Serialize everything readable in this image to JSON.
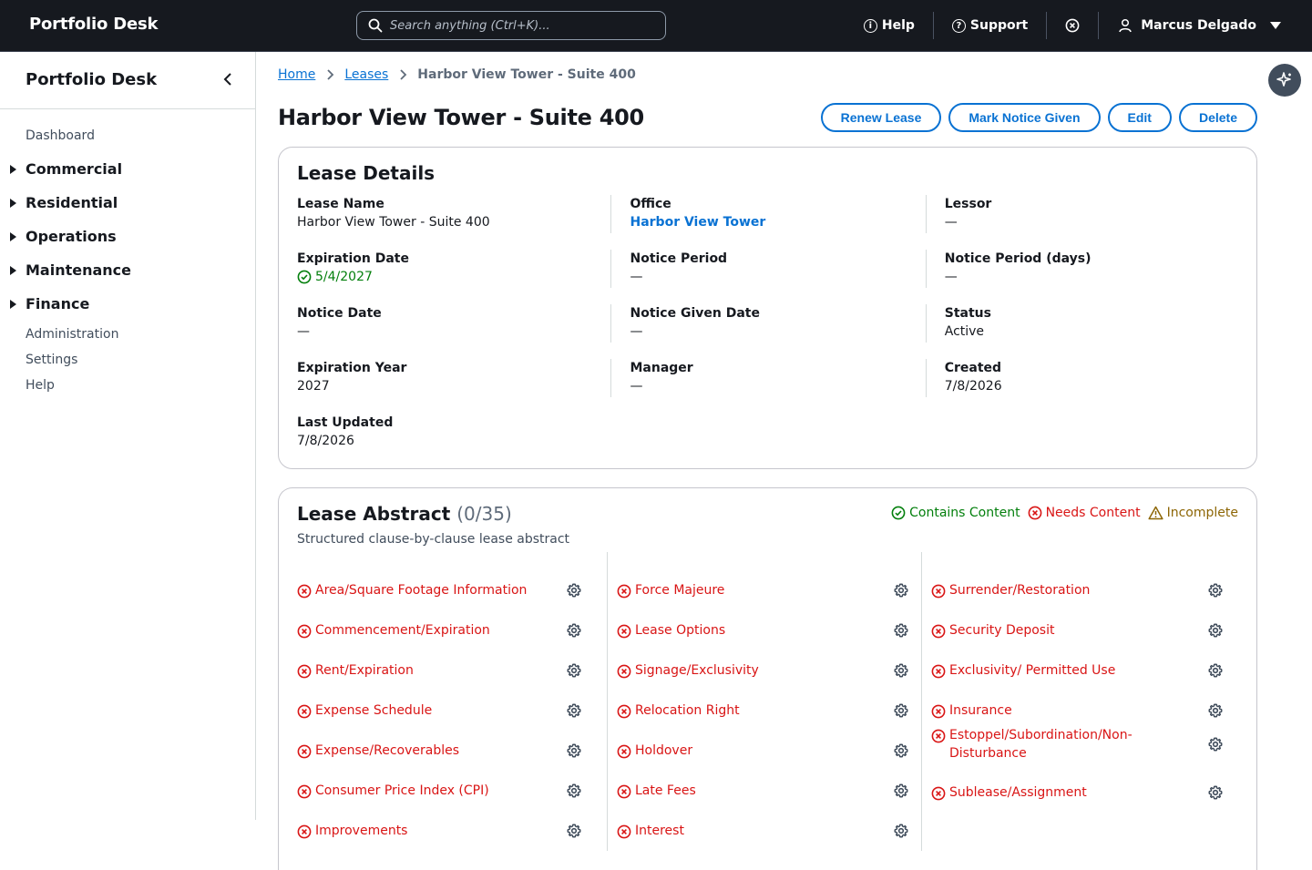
{
  "app": {
    "brand": "Portfolio Desk",
    "search_placeholder": "Search anything (Ctrl+K)...",
    "help_label": "Help",
    "support_label": "Support",
    "user_name": "Marcus Delgado"
  },
  "sidebar": {
    "title": "Portfolio Desk",
    "dashboard": "Dashboard",
    "groups": [
      "Commercial",
      "Residential",
      "Operations",
      "Maintenance",
      "Finance"
    ],
    "links": [
      "Administration",
      "Settings",
      "Help"
    ]
  },
  "breadcrumb": {
    "home": "Home",
    "leases": "Leases",
    "current": "Harbor View Tower - Suite 400"
  },
  "page": {
    "title": "Harbor View Tower - Suite 400",
    "actions": {
      "renew": "Renew Lease",
      "notice": "Mark Notice Given",
      "edit": "Edit",
      "delete": "Delete"
    }
  },
  "details": {
    "title": "Lease Details",
    "fields": {
      "lease_name": {
        "label": "Lease Name",
        "value": "Harbor View Tower - Suite 400"
      },
      "office": {
        "label": "Office",
        "value": "Harbor View Tower"
      },
      "lessor": {
        "label": "Lessor",
        "value": "—"
      },
      "expiration_date": {
        "label": "Expiration Date",
        "value": "5/4/2027"
      },
      "notice_period": {
        "label": "Notice Period",
        "value": "—"
      },
      "notice_period_days": {
        "label": "Notice Period (days)",
        "value": "—"
      },
      "notice_date": {
        "label": "Notice Date",
        "value": "—"
      },
      "notice_given_date": {
        "label": "Notice Given Date",
        "value": "—"
      },
      "status": {
        "label": "Status",
        "value": "Active"
      },
      "expiration_year": {
        "label": "Expiration Year",
        "value": "2027"
      },
      "manager": {
        "label": "Manager",
        "value": "—"
      },
      "created": {
        "label": "Created",
        "value": "7/8/2026"
      },
      "last_updated": {
        "label": "Last Updated",
        "value": "7/8/2026"
      }
    }
  },
  "abstract": {
    "title": "Lease Abstract",
    "count": "(0/35)",
    "subtitle": "Structured clause-by-clause lease abstract",
    "legend": {
      "contains": "Contains Content",
      "needs": "Needs Content",
      "incomplete": "Incomplete"
    },
    "col1": [
      "Area/Square Footage Information",
      "Commencement/Expiration",
      "Rent/Expiration",
      "Expense Schedule",
      "Expense/Recoverables",
      "Consumer Price Index (CPI)",
      "Improvements"
    ],
    "col2": [
      "Force Majeure",
      "Lease Options",
      "Signage/Exclusivity",
      "Relocation Right",
      "Holdover",
      "Late Fees",
      "Interest"
    ],
    "col3": [
      "Surrender/Restoration",
      "Security Deposit",
      "Exclusivity/ Permitted Use",
      "Insurance",
      "Estoppel/Subordination/Non-Disturbance",
      "Sublease/Assignment"
    ]
  },
  "colors": {
    "topbar": "#16191f",
    "link": "#0972d3",
    "error": "#d91515",
    "success": "#037f0c",
    "warning": "#8d6605"
  }
}
